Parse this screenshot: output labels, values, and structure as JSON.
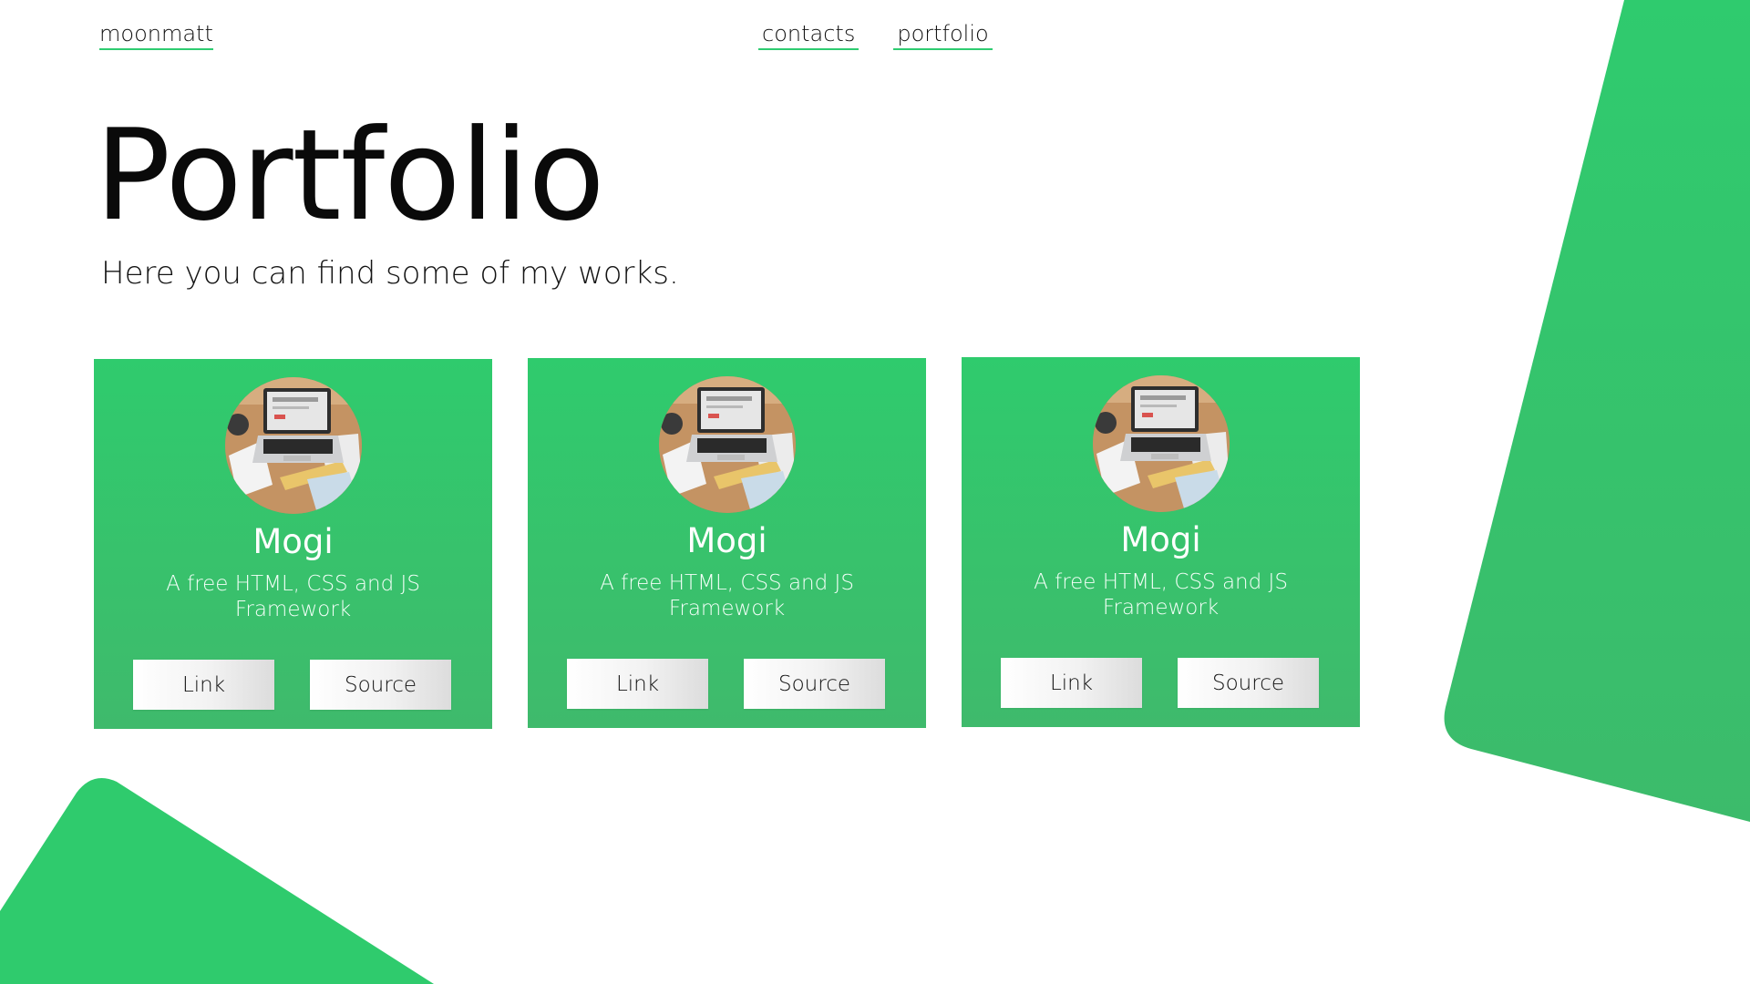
{
  "brand": "moonmatt",
  "nav": {
    "links": [
      "contacts",
      "portfolio"
    ]
  },
  "hero": {
    "title": "Portfolio",
    "subtitle": "Here you can find some of my works."
  },
  "cards": [
    {
      "title": "Mogi",
      "description": "A free HTML, CSS and JS Framework",
      "link_label": "Link",
      "source_label": "Source",
      "image": "laptop-on-desk-photo"
    },
    {
      "title": "Mogi",
      "description": "A free HTML, CSS and JS Framework",
      "link_label": "Link",
      "source_label": "Source",
      "image": "laptop-on-desk-photo"
    },
    {
      "title": "Mogi",
      "description": "A free HTML, CSS and JS Framework",
      "link_label": "Link",
      "source_label": "Source",
      "image": "laptop-on-desk-photo"
    }
  ],
  "colors": {
    "accent": "#2ecc71",
    "card_top": "#2fcb6d",
    "card_bottom": "#3fba6c"
  }
}
